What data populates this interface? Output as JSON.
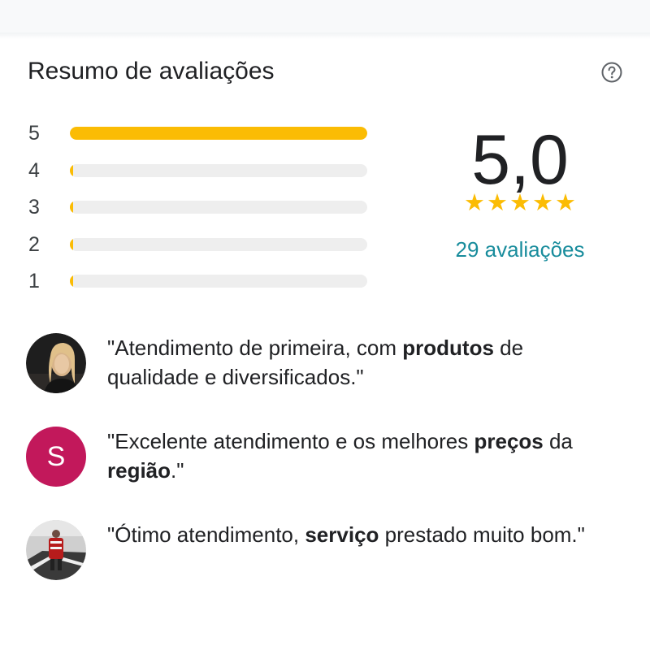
{
  "header": {
    "title": "Resumo de avaliações",
    "help_icon": "help-circle-icon"
  },
  "histogram": [
    {
      "stars": "5",
      "fraction": 1.0
    },
    {
      "stars": "4",
      "fraction": 0.0
    },
    {
      "stars": "3",
      "fraction": 0.0
    },
    {
      "stars": "2",
      "fraction": 0.0
    },
    {
      "stars": "1",
      "fraction": 0.0
    }
  ],
  "summary": {
    "rating": "5,0",
    "stars_filled": 5,
    "reviews_count": "29 avaliações",
    "star_color": "#fbbc04",
    "link_color": "#188c9c"
  },
  "reviews": [
    {
      "avatar": "photo",
      "segments": [
        {
          "text": "\"Atendimento de primeira, com ",
          "bold": false
        },
        {
          "text": "produtos",
          "bold": true
        },
        {
          "text": " de qualidade e diversificados.\"",
          "bold": false
        }
      ]
    },
    {
      "avatar": "letter",
      "avatar_letter": "S",
      "avatar_color": "#c2185b",
      "segments": [
        {
          "text": "\"Excelente atendimento e os melhores ",
          "bold": false
        },
        {
          "text": "preços",
          "bold": true
        },
        {
          "text": " da ",
          "bold": false
        },
        {
          "text": "região",
          "bold": true
        },
        {
          "text": ".\"",
          "bold": false
        }
      ]
    },
    {
      "avatar": "photo",
      "segments": [
        {
          "text": "\"Ótimo atendimento, ",
          "bold": false
        },
        {
          "text": "serviço",
          "bold": true
        },
        {
          "text": " prestado muito bom.\"",
          "bold": false
        }
      ]
    }
  ]
}
